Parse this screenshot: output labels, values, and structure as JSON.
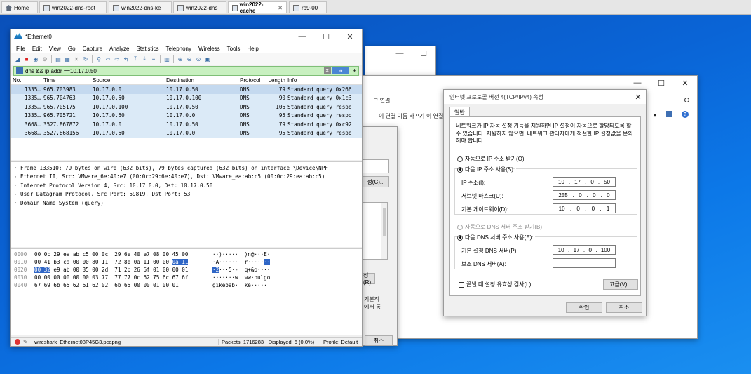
{
  "vm_tabs": [
    {
      "label": "Home"
    },
    {
      "label": "win2022-dns-root"
    },
    {
      "label": "win2022-dns-ke"
    },
    {
      "label": "win2022-dns"
    },
    {
      "label": "win2022-cache"
    },
    {
      "label": "ro9-00"
    }
  ],
  "wireshark": {
    "title": "*Ethernet0",
    "menu": [
      "File",
      "Edit",
      "View",
      "Go",
      "Capture",
      "Analyze",
      "Statistics",
      "Telephony",
      "Wireless",
      "Tools",
      "Help"
    ],
    "filter": "dns && ip.addr ==10.17.0.50",
    "columns": {
      "no": "No.",
      "time": "Time",
      "src": "Source",
      "dst": "Destination",
      "proto": "Protocol",
      "len": "Length",
      "info": "Info"
    },
    "packets": [
      {
        "no": "1335…",
        "time": "965.703983",
        "src": "10.17.0.0",
        "dst": "10.17.0.50",
        "proto": "DNS",
        "len": "79",
        "info": "Standard query 0x266"
      },
      {
        "no": "1335…",
        "time": "965.704763",
        "src": "10.17.0.50",
        "dst": "10.17.0.100",
        "proto": "DNS",
        "len": "90",
        "info": "Standard query 0x1c3"
      },
      {
        "no": "1335…",
        "time": "965.705175",
        "src": "10.17.0.100",
        "dst": "10.17.0.50",
        "proto": "DNS",
        "len": "106",
        "info": "Standard query respo"
      },
      {
        "no": "1335…",
        "time": "965.705721",
        "src": "10.17.0.50",
        "dst": "10.17.0.0",
        "proto": "DNS",
        "len": "95",
        "info": "Standard query respo"
      },
      {
        "no": "3668…",
        "time": "3527.867872",
        "src": "10.17.0.0",
        "dst": "10.17.0.50",
        "proto": "DNS",
        "len": "79",
        "info": "Standard query 0xc92"
      },
      {
        "no": "3668…",
        "time": "3527.868156",
        "src": "10.17.0.50",
        "dst": "10.17.0.0",
        "proto": "DNS",
        "len": "95",
        "info": "Standard query respo"
      }
    ],
    "details": [
      "Frame 133510: 79 bytes on wire (632 bits), 79 bytes captured (632 bits) on interface \\Device\\NPF_",
      "Ethernet II, Src: VMware_6e:40:e7 (00:0c:29:6e:40:e7), Dst: VMware_ea:ab:c5 (00:0c:29:ea:ab:c5)",
      "Internet Protocol Version 4, Src: 10.17.0.0, Dst: 10.17.0.50",
      "User Datagram Protocol, Src Port: 59819, Dst Port: 53",
      "Domain Name System (query)"
    ],
    "bytes": [
      {
        "off": "0000",
        "hex_a": "00 0c 29 ea ab c5 00 0c  29 6e 40 e7 08 00 45 00",
        "hex_hl": "",
        "hex_b": "",
        "asc_a": "··)·····  )n@···E·",
        "asc_hl": "",
        "asc_b": ""
      },
      {
        "off": "0010",
        "hex_a": "00 41 b3 ca 00 00 80 11  72 8e 0a 11 00 00 ",
        "hex_hl": "0a 11",
        "hex_b": "",
        "asc_a": "·A······  r·····",
        "asc_hl": "··",
        "asc_b": ""
      },
      {
        "off": "0020",
        "hex_a": "",
        "hex_hl": "00 32",
        "hex_b": " e9 ab 00 35 00 2d  71 2b 26 6f 01 00 00 01",
        "asc_a": "",
        "asc_hl": "·2",
        "asc_b": "···5·-  q+&o····"
      },
      {
        "off": "0030",
        "hex_a": "00 00 00 00 00 00 03 77  77 77 0c 62 75 6c 67 6f",
        "hex_hl": "",
        "hex_b": "",
        "asc_a": "·······w  ww·bulgo",
        "asc_hl": "",
        "asc_b": ""
      },
      {
        "off": "0040",
        "hex_a": "67 69 6b 65 62 61 62 02  6b 65 00 00 01 00 01",
        "hex_hl": "",
        "hex_b": "",
        "asc_a": "gikebab·  ke·····",
        "asc_hl": "",
        "asc_b": ""
      }
    ],
    "status": {
      "file": "wireshark_Ethernet08P45G3.pcapng",
      "packets": "Packets: 1716283 · Displayed: 6 (0.0%)",
      "profile": "Profile: Default"
    }
  },
  "explorer": {
    "title_fragment": "크 연결",
    "toolbar_fragment": "이 연결 이름 바꾸기",
    "toolbar_fragment2": "이 연결",
    "netdlg_btn1": "정(C)...",
    "netdlg_btn2": "성(R)",
    "netdlg_text": "기본적\n에서 통",
    "netdlg_cancel": "취소"
  },
  "ipv4": {
    "title": "인터넷 프로토콜 버전 4(TCP/IPv4) 속성",
    "tab": "일반",
    "description": "네트워크가 IP 자동 설정 기능을 지원하면 IP 설정이 자동으로 할당되도록 할 수 있습니다. 지원하지 않으면, 네트워크 관리자에게 적절한 IP 설정값을 문의해야 합니다.",
    "auto_ip": "자동으로 IP 주소 받기(O)",
    "manual_ip": "다음 IP 주소 사용(S):",
    "ip_label": "IP 주소(I):",
    "ip": [
      "10",
      "17",
      "0",
      "50"
    ],
    "mask_label": "서브넷 마스크(U):",
    "mask": [
      "255",
      "0",
      "0",
      "0"
    ],
    "gw_label": "기본 게이트웨이(D):",
    "gw": [
      "10",
      "0",
      "0",
      "1"
    ],
    "auto_dns": "자동으로 DNS 서버 주소 받기(B)",
    "manual_dns": "다음 DNS 서버 주소 사용(E):",
    "dns1_label": "기본 설정 DNS 서버(P):",
    "dns1": [
      "10",
      "17",
      "0",
      "100"
    ],
    "dns2_label": "보조 DNS 서버(A):",
    "dns2": [
      "",
      "",
      "",
      ""
    ],
    "validate": "끝낼 때 설정 유효성 검사(L)",
    "advanced": "고급(V)...",
    "ok": "확인",
    "cancel": "취소"
  }
}
